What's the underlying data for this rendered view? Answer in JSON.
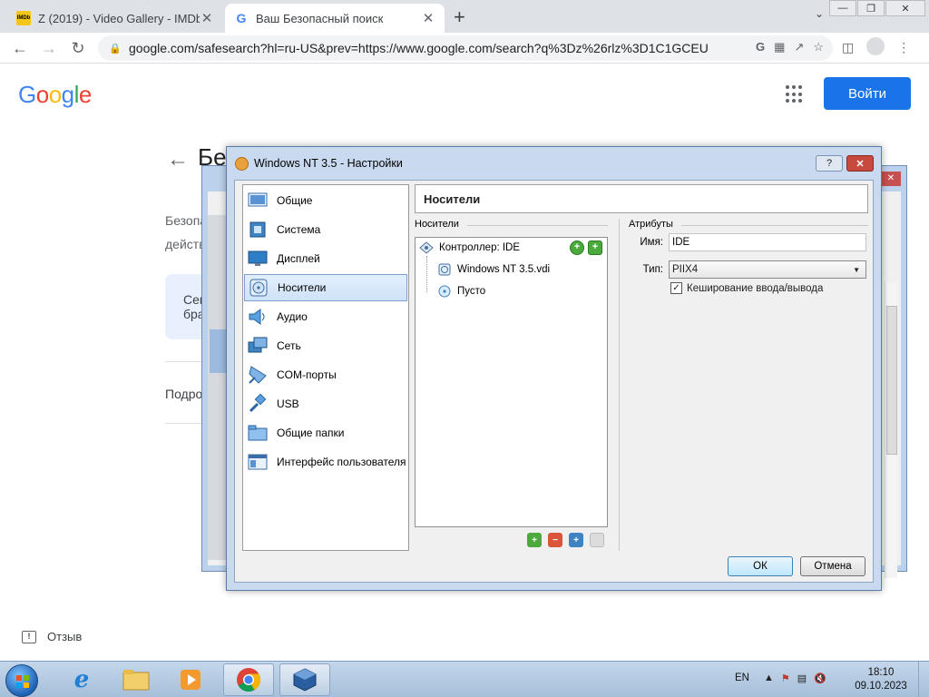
{
  "browser": {
    "tabs": [
      {
        "title": "Z (2019) - Video Gallery - IMDb",
        "favicon": "IMDb",
        "active": false
      },
      {
        "title": "Ваш Безопасный поиск",
        "favicon": "G",
        "active": true
      }
    ],
    "url": "google.com/safesearch?hl=ru-US&prev=https://www.google.com/search?q%3Dz%26rlz%3D1C1GCEU...",
    "newtab_label": "+",
    "tab_close_glyph": "✕"
  },
  "google": {
    "logo": {
      "G": "G",
      "o1": "o",
      "o2": "o",
      "g": "g",
      "l": "l",
      "e": "e"
    },
    "signin_label": "Войти",
    "heading_fragment": "Бе",
    "desc_fragment_1": "Безопа",
    "desc_fragment_2": "действ",
    "card_fragment_1": "Сег",
    "card_fragment_2": "бра",
    "more_fragment": "Подро",
    "feedback_label": "Отзыв"
  },
  "dialog": {
    "title": "Windows NT 3.5 - Настройки",
    "help_glyph": "?",
    "close_glyph": "✕",
    "categories": [
      {
        "label": "Общие",
        "icon": "general-icon"
      },
      {
        "label": "Система",
        "icon": "system-chip-icon"
      },
      {
        "label": "Дисплей",
        "icon": "display-monitor-icon"
      },
      {
        "label": "Носители",
        "icon": "storage-disc-icon"
      },
      {
        "label": "Аудио",
        "icon": "audio-speaker-icon"
      },
      {
        "label": "Сеть",
        "icon": "network-icon"
      },
      {
        "label": "COM-порты",
        "icon": "serial-port-icon"
      },
      {
        "label": "USB",
        "icon": "usb-icon"
      },
      {
        "label": "Общие папки",
        "icon": "shared-folder-icon"
      },
      {
        "label": "Интерфейс пользователя",
        "icon": "user-interface-icon"
      }
    ],
    "selected_category": "Носители",
    "panel_title": "Носители",
    "storage_group_label": "Носители",
    "tree": {
      "controller": "Контроллер: IDE",
      "children": [
        {
          "label": "Windows NT 3.5.vdi",
          "icon": "hard-disk-icon"
        },
        {
          "label": "Пусто",
          "icon": "optical-disc-icon"
        }
      ]
    },
    "attributes": {
      "group_label": "Атрибуты",
      "name_label": "Имя:",
      "name_value": "IDE",
      "type_label": "Тип:",
      "type_value": "PIIX4",
      "cache_label": "Кеширование ввода/вывода",
      "cache_checked": true
    },
    "ok_label": "ОК",
    "cancel_label": "Отмена"
  },
  "taskbar": {
    "language": "EN",
    "time": "18:10",
    "date": "09.10.2023"
  },
  "colors": {
    "google_blue": "#1a73e8",
    "dialog_frame": "#c9daf0",
    "selection": "#cfe2f8",
    "taskbar": "#a6bfda"
  }
}
